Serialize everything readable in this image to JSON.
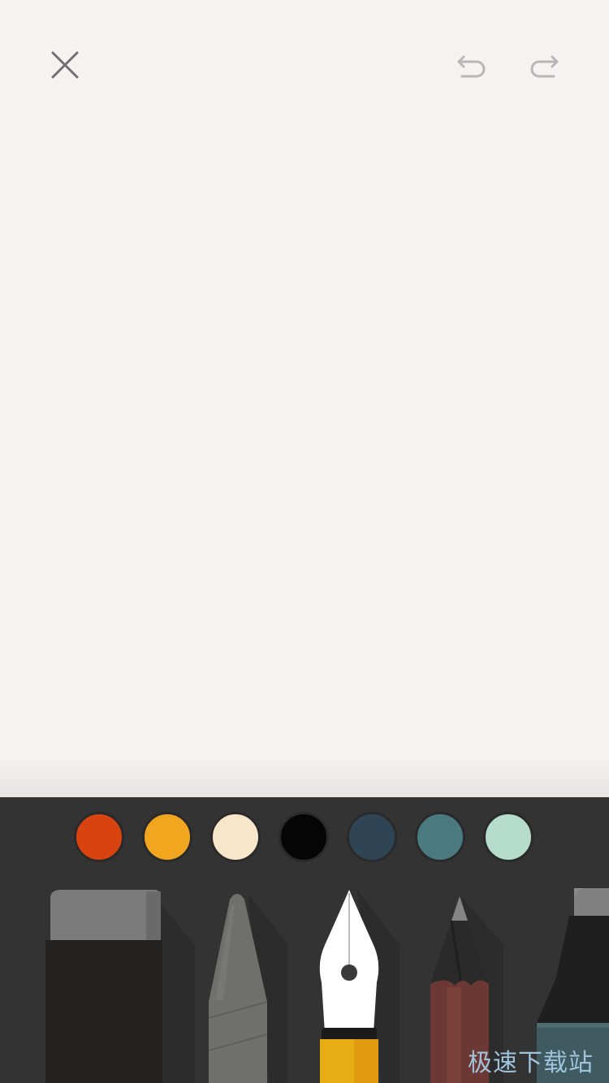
{
  "toolbar": {
    "close_icon": "close-icon",
    "undo_icon": "undo-icon",
    "redo_icon": "redo-icon"
  },
  "palette": {
    "colors": [
      "#d9430f",
      "#f2a620",
      "#f8e6cb",
      "#050505",
      "#2f4555",
      "#4a7a80",
      "#b5dccd"
    ],
    "selected_index": null
  },
  "tools": [
    {
      "name": "eraser",
      "icon": "eraser-icon"
    },
    {
      "name": "pencil-sketch",
      "icon": "sketch-pencil-icon"
    },
    {
      "name": "fountain-pen",
      "icon": "fountain-pen-icon",
      "selected": true
    },
    {
      "name": "pencil",
      "icon": "pencil-icon"
    },
    {
      "name": "marker",
      "icon": "marker-icon"
    }
  ],
  "watermark": {
    "text": "极速下载站"
  }
}
